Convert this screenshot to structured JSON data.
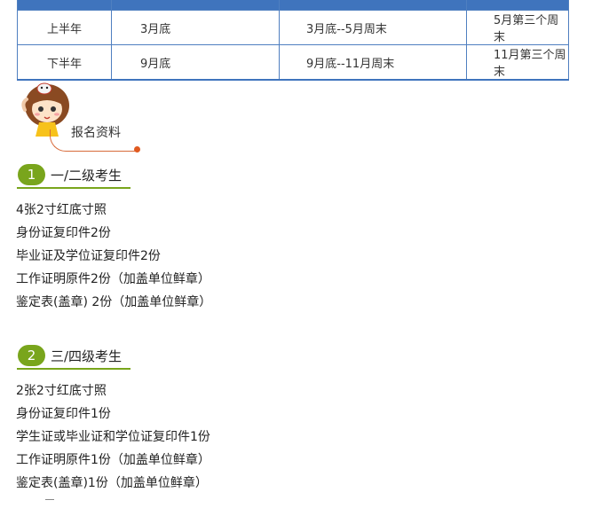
{
  "schedule": {
    "headers": [
      "",
      "",
      "",
      ""
    ],
    "rows": [
      {
        "term": "上半年",
        "c2": "3月底",
        "c3": "3月底--5月周末",
        "c4": "5月第三个周末"
      },
      {
        "term": "下半年",
        "c2": "9月底",
        "c3": "9月底--11月周末",
        "c4": "11月第三个周末"
      }
    ]
  },
  "badge": {
    "title": "报名资料",
    "icon": "cartoon-girl-icon"
  },
  "colors": {
    "table_header": "#3f74bd",
    "table_border": "#4f7fc0",
    "section_green": "#79a51c",
    "accent_orange": "#e05a20"
  },
  "sections": [
    {
      "number": "1",
      "title": "一/二级考生",
      "items": [
        "4张2寸红底寸照",
        "身份证复印件2份",
        "毕业证及学位证复印件2份",
        "工作证明原件2份（加盖单位鲜章）",
        "鉴定表(盖章) 2份（加盖单位鲜章）"
      ]
    },
    {
      "number": "2",
      "title": "三/四级考生",
      "items": [
        "2张2寸红底寸照",
        "身份证复印件1份",
        "学生证或毕业证和学位证复印件1份",
        "工作证明原件1份（加盖单位鲜章）",
        "鉴定表(盖章)1份（加盖单位鲜章）"
      ]
    }
  ]
}
